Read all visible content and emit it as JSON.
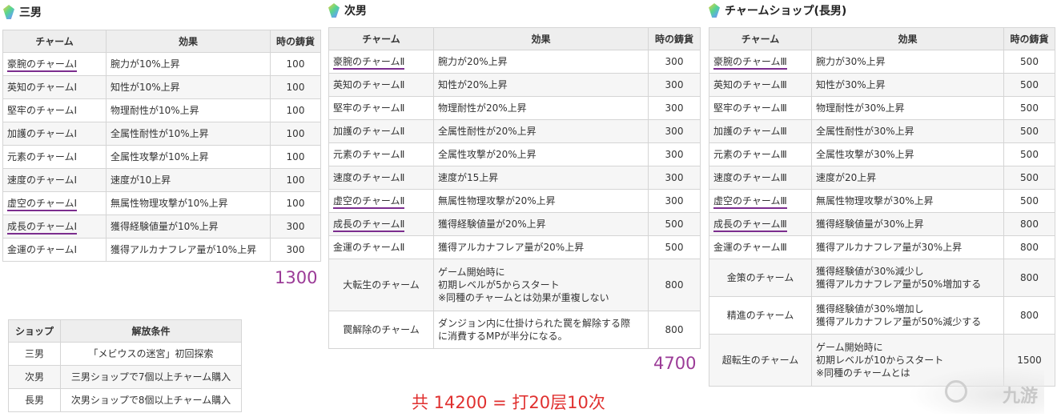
{
  "panels": [
    {
      "title": "三男",
      "headers": [
        "チャーム",
        "効果",
        "時の鋳貨"
      ],
      "rows": [
        {
          "name": "豪腕のチャームⅠ",
          "effect": "腕力が10%上昇",
          "cost": "100"
        },
        {
          "name": "英知のチャームⅠ",
          "effect": "知性が10%上昇",
          "cost": "100"
        },
        {
          "name": "堅牢のチャームⅠ",
          "effect": "物理耐性が10%上昇",
          "cost": "100"
        },
        {
          "name": "加護のチャームⅠ",
          "effect": "全属性耐性が10%上昇",
          "cost": "100"
        },
        {
          "name": "元素のチャームⅠ",
          "effect": "全属性攻撃が10%上昇",
          "cost": "100"
        },
        {
          "name": "速度のチャームⅠ",
          "effect": "速度が10上昇",
          "cost": "100"
        },
        {
          "name": "虚空のチャームⅠ",
          "effect": "無属性物理攻撃が10%上昇",
          "cost": "100"
        },
        {
          "name": "成長のチャームⅠ",
          "effect": "獲得経験値量が10%上昇",
          "cost": "300"
        },
        {
          "name": "金運のチャームⅠ",
          "effect": "獲得アルカナフレア量が10%上昇",
          "cost": "300"
        }
      ],
      "total": "1300"
    },
    {
      "title": "次男",
      "headers": [
        "チャーム",
        "効果",
        "時の鋳貨"
      ],
      "rows": [
        {
          "name": "豪腕のチャームⅡ",
          "effect": "腕力が20%上昇",
          "cost": "300"
        },
        {
          "name": "英知のチャームⅡ",
          "effect": "知性が20%上昇",
          "cost": "300"
        },
        {
          "name": "堅牢のチャームⅡ",
          "effect": "物理耐性が20%上昇",
          "cost": "300"
        },
        {
          "name": "加護のチャームⅡ",
          "effect": "全属性耐性が20%上昇",
          "cost": "300"
        },
        {
          "name": "元素のチャームⅡ",
          "effect": "全属性攻撃が20%上昇",
          "cost": "300"
        },
        {
          "name": "速度のチャームⅡ",
          "effect": "速度が15上昇",
          "cost": "300"
        },
        {
          "name": "虚空のチャームⅡ",
          "effect": "無属性物理攻撃が20%上昇",
          "cost": "300"
        },
        {
          "name": "成長のチャームⅡ",
          "effect": "獲得経験値量が20%上昇",
          "cost": "500"
        },
        {
          "name": "金運のチャームⅡ",
          "effect": "獲得アルカナフレア量が20%上昇",
          "cost": "500"
        },
        {
          "name": "大転生のチャーム",
          "effect_lines": [
            "ゲーム開始時に",
            "初期レベルが5からスタート",
            "※同種のチャームとは効果が重複しない"
          ],
          "cost": "800"
        },
        {
          "name": "罠解除のチャーム",
          "effect_lines": [
            "ダンジョン内に仕掛けられた罠を解除する際",
            "に消費するMPが半分になる。"
          ],
          "cost": "800"
        }
      ],
      "total": "4700"
    },
    {
      "title": "チャームショップ(長男)",
      "headers": [
        "チャーム",
        "効果",
        "時の鋳貨"
      ],
      "rows": [
        {
          "name": "豪腕のチャームⅢ",
          "effect": "腕力が30%上昇",
          "cost": "500"
        },
        {
          "name": "英知のチャームⅢ",
          "effect": "知性が30%上昇",
          "cost": "500"
        },
        {
          "name": "堅牢のチャームⅢ",
          "effect": "物理耐性が30%上昇",
          "cost": "500"
        },
        {
          "name": "加護のチャームⅢ",
          "effect": "全属性耐性が30%上昇",
          "cost": "500"
        },
        {
          "name": "元素のチャームⅢ",
          "effect": "全属性攻撃が30%上昇",
          "cost": "500"
        },
        {
          "name": "速度のチャームⅢ",
          "effect": "速度が20上昇",
          "cost": "500"
        },
        {
          "name": "虚空のチャームⅢ",
          "effect": "無属性物理攻撃が30%上昇",
          "cost": "500"
        },
        {
          "name": "成長のチャームⅢ",
          "effect": "獲得経験値量が30%上昇",
          "cost": "800"
        },
        {
          "name": "金運のチャームⅢ",
          "effect": "獲得アルカナフレア量が30%上昇",
          "cost": "800"
        },
        {
          "name": "金策のチャーム",
          "effect_lines": [
            "獲得経験値が30%減少し",
            "獲得アルカナフレア量が50%増加する"
          ],
          "cost": "800"
        },
        {
          "name": "精進のチャーム",
          "effect_lines": [
            "獲得経験値が30%増加し",
            "獲得アルカナフレア量が50%減少する"
          ],
          "cost": "800"
        },
        {
          "name": "超転生のチャーム",
          "effect_lines": [
            "ゲーム開始時に",
            "初期レベルが10からスタート",
            "※同種のチャームとは"
          ],
          "cost": "1500"
        }
      ]
    }
  ],
  "unlock_table": {
    "headers": [
      "ショップ",
      "解放条件"
    ],
    "rows": [
      {
        "shop": "三男",
        "condition": "「メビウスの迷宮」初回探索"
      },
      {
        "shop": "次男",
        "condition": "三男ショップで7個以上チャーム購入"
      },
      {
        "shop": "長男",
        "condition": "次男ショップで8個以上チャーム購入"
      }
    ]
  },
  "grand_total": "共 14200 = 打20层10次",
  "watermark": "九游",
  "colors": {
    "accent_total": "#9b3b97",
    "grand_total": "#e0302f",
    "header_bg": "#eeeeee",
    "border": "#d5d5d5",
    "underline": "#7b2d8e"
  },
  "icons": {
    "section": "gem-icon"
  }
}
